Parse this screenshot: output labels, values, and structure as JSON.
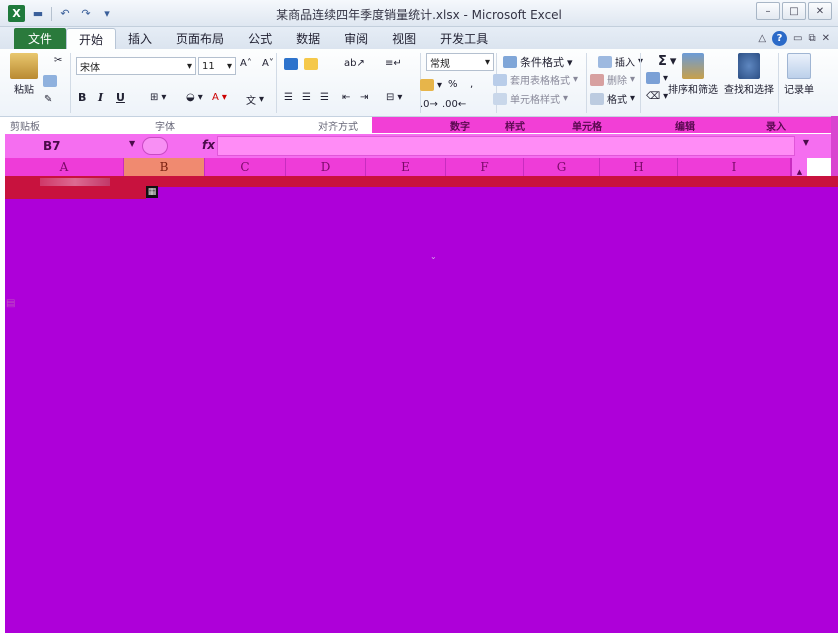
{
  "window": {
    "title": "某商品连续四年季度销量统计.xlsx - Microsoft Excel",
    "app_icon": "X",
    "quick_access": [
      "save-icon",
      "undo-icon",
      "redo-icon",
      "customize-icon"
    ],
    "controls": [
      "minimize",
      "restore",
      "close"
    ]
  },
  "tabs": {
    "file": "文件",
    "items": [
      "开始",
      "插入",
      "页面布局",
      "公式",
      "数据",
      "审阅",
      "视图",
      "开发工具"
    ],
    "active": "开始"
  },
  "ribbon": {
    "clipboard": {
      "paste": "粘贴",
      "label": "剪贴板"
    },
    "font": {
      "name": "宋体",
      "size": "11",
      "bold": "B",
      "italic": "I",
      "underline": "U",
      "label": "字体"
    },
    "alignment": {
      "label": "对齐方式"
    },
    "number": {
      "format": "常规",
      "percent": "%",
      "comma": ",",
      "label": "数字"
    },
    "styles": {
      "conditional": "条件格式",
      "table": "套用表格格式",
      "cell": "单元格样式",
      "label": "样式"
    },
    "cells": {
      "insert": "插入",
      "delete": "删除",
      "format": "格式",
      "label": "单元格"
    },
    "editing": {
      "sort_filter": "排序和筛选",
      "find_select": "查找和选择",
      "label": "编辑"
    },
    "records": {
      "record_sheet": "记录单",
      "label": "录入"
    }
  },
  "formula_bar": {
    "name_box": "B7",
    "fx": "fx",
    "value": ""
  },
  "columns": [
    "A",
    "B",
    "C",
    "D",
    "E",
    "F",
    "G",
    "H",
    "I"
  ],
  "selected_column": "B",
  "colors": {
    "file_tab": "#2a7a3c",
    "sheet_background": "#ae00d9",
    "header_pink": "#ee3cd8",
    "selection_band": "#c8123e"
  }
}
